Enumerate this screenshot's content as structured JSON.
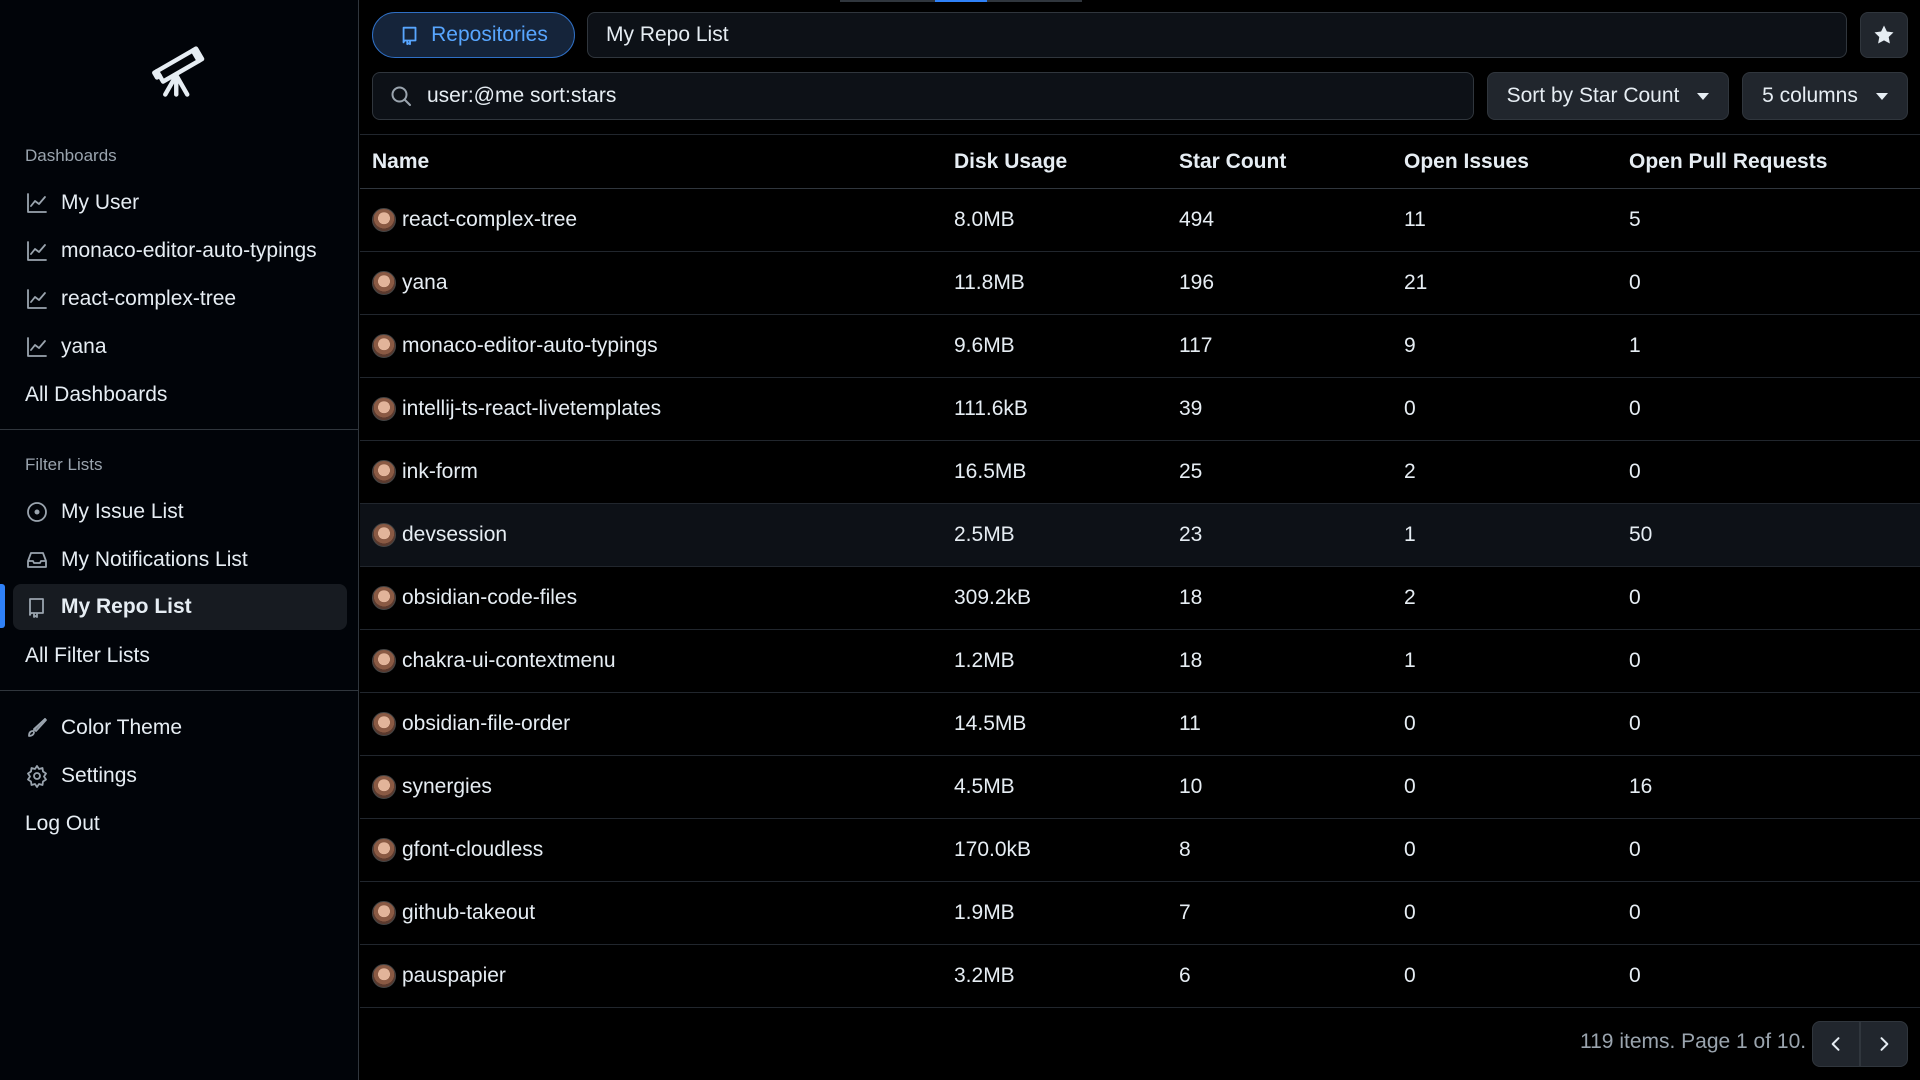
{
  "sidebar": {
    "dashboards_label": "Dashboards",
    "dashboards": [
      {
        "label": "My User",
        "icon": "graph-icon"
      },
      {
        "label": "monaco-editor-auto-typings",
        "icon": "graph-icon"
      },
      {
        "label": "react-complex-tree",
        "icon": "graph-icon"
      },
      {
        "label": "yana",
        "icon": "graph-icon"
      }
    ],
    "all_dashboards": "All Dashboards",
    "filter_lists_label": "Filter Lists",
    "filter_lists": [
      {
        "label": "My Issue List",
        "icon": "issue-icon"
      },
      {
        "label": "My Notifications List",
        "icon": "inbox-icon"
      },
      {
        "label": "My Repo List",
        "icon": "repo-icon",
        "active": true
      }
    ],
    "all_filter_lists": "All Filter Lists",
    "color_theme": "Color Theme",
    "settings": "Settings",
    "log_out": "Log Out"
  },
  "header": {
    "type_label": "Repositories",
    "title_value": "My Repo List",
    "search_value": "user:@me sort:stars",
    "sort_label": "Sort by Star Count",
    "columns_label": "5 columns"
  },
  "table": {
    "columns": [
      "Name",
      "Disk Usage",
      "Star Count",
      "Open Issues",
      "Open Pull Requests"
    ],
    "rows": [
      [
        "react-complex-tree",
        "8.0MB",
        "494",
        "11",
        "5"
      ],
      [
        "yana",
        "11.8MB",
        "196",
        "21",
        "0"
      ],
      [
        "monaco-editor-auto-typings",
        "9.6MB",
        "117",
        "9",
        "1"
      ],
      [
        "intellij-ts-react-livetemplates",
        "111.6kB",
        "39",
        "0",
        "0"
      ],
      [
        "ink-form",
        "16.5MB",
        "25",
        "2",
        "0"
      ],
      [
        "devsession",
        "2.5MB",
        "23",
        "1",
        "50"
      ],
      [
        "obsidian-code-files",
        "309.2kB",
        "18",
        "2",
        "0"
      ],
      [
        "chakra-ui-contextmenu",
        "1.2MB",
        "18",
        "1",
        "0"
      ],
      [
        "obsidian-file-order",
        "14.5MB",
        "11",
        "0",
        "0"
      ],
      [
        "synergies",
        "4.5MB",
        "10",
        "0",
        "16"
      ],
      [
        "gfont-cloudless",
        "170.0kB",
        "8",
        "0",
        "0"
      ],
      [
        "github-takeout",
        "1.9MB",
        "7",
        "0",
        "0"
      ],
      [
        "pauspapier",
        "3.2MB",
        "6",
        "0",
        "0"
      ]
    ]
  },
  "footer": {
    "pagination_text": "119 items. Page 1 of 10."
  },
  "colors": {
    "accent": "#2f81f7",
    "background": "#000000",
    "sidebar": "#010409"
  }
}
